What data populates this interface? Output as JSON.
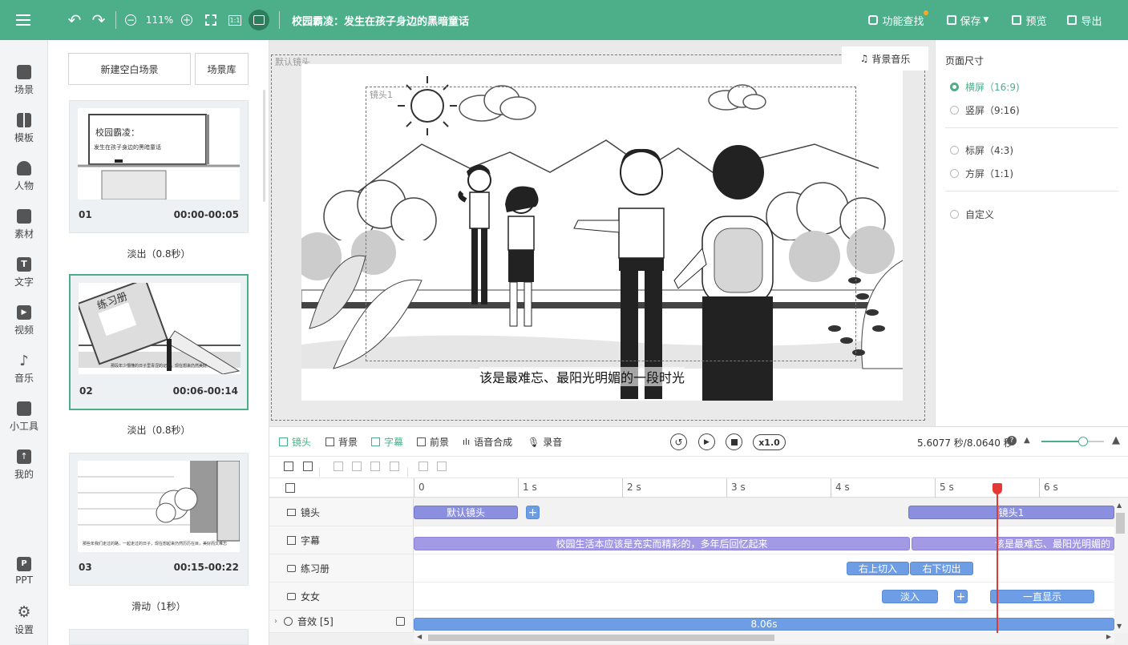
{
  "topbar": {
    "zoom": "111%",
    "title": "校园霸凌：发生在孩子身边的黑暗童话",
    "feature_search": "功能查找",
    "save": "保存",
    "preview": "预览",
    "export": "导出"
  },
  "leftnav": {
    "items": [
      {
        "label": "场景"
      },
      {
        "label": "模板"
      },
      {
        "label": "人物"
      },
      {
        "label": "素材"
      },
      {
        "label": "文字"
      },
      {
        "label": "视频"
      },
      {
        "label": "音乐"
      },
      {
        "label": "小工具"
      },
      {
        "label": "我的"
      },
      {
        "label": "PPT"
      },
      {
        "label": "设置"
      }
    ]
  },
  "scenes": {
    "new_blank": "新建空白场景",
    "library": "场景库",
    "items": [
      {
        "no": "01",
        "time": "00:00-00:05",
        "transition": "淡出（0.8秒）",
        "thumb_text1": "校园霸凌：",
        "thumb_text2": "发生在孩子身边的黑暗童话"
      },
      {
        "no": "02",
        "time": "00:06-00:14",
        "transition": "淡出（0.8秒）",
        "thumb_text1": "练习册",
        "thumb_text2": "那段年少懵懂的日子里青涩的记忆，现在想来仍然美好"
      },
      {
        "no": "03",
        "time": "00:15-00:22",
        "transition": "滑动（1秒）",
        "thumb_text2": "那些年我们走过的路，一起走过的日子，现在想起来仍然历历在目，美好而又难忘"
      }
    ]
  },
  "canvas": {
    "default_lens": "默认镜头",
    "lens1": "镜头1",
    "bg_music": "背景音乐",
    "subtitle": "该是最难忘、最阳光明媚的一段时光"
  },
  "rightpanel": {
    "title": "页面尺寸",
    "options": [
      {
        "label": "横屏（16:9)"
      },
      {
        "label": "竖屏（9:16)"
      },
      {
        "label": "标屏（4:3)"
      },
      {
        "label": "方屏（1:1)"
      },
      {
        "label": "自定义"
      }
    ]
  },
  "timeline": {
    "tabs": {
      "lens": "镜头",
      "bg": "背景",
      "subtitle": "字幕",
      "fg": "前景",
      "tts": "语音合成",
      "record": "录音"
    },
    "speed": "x1.0",
    "time_readout": "5.6077 秒/8.0640 秒",
    "ruler": [
      "0",
      "1 s",
      "2 s",
      "3 s",
      "4 s",
      "5 s",
      "6 s"
    ],
    "tracks": {
      "lens": "镜头",
      "subtitle": "字幕",
      "workbook": "练习册",
      "girl": "女女",
      "sfx": "音效 [5]"
    },
    "clips": {
      "default_lens": "默认镜头",
      "lens1": "镜头1",
      "sub1": "校园生活本应该是充实而精彩的，多年后回忆起来",
      "sub2": "该是最难忘、最阳光明媚的",
      "wb_in": "右上切入",
      "wb_out": "右下切出",
      "girl_in": "淡入",
      "girl_show": "一直显示",
      "sfx": "8.06s"
    },
    "playhead_seconds": 5.6077,
    "total_seconds": 8.064
  },
  "colors": {
    "accent": "#4caf8a",
    "lens_clip": "#8b8fe0",
    "subtitle_clip": "#a29ae4",
    "anim_clip": "#6d9de5",
    "playhead": "#e53935"
  }
}
